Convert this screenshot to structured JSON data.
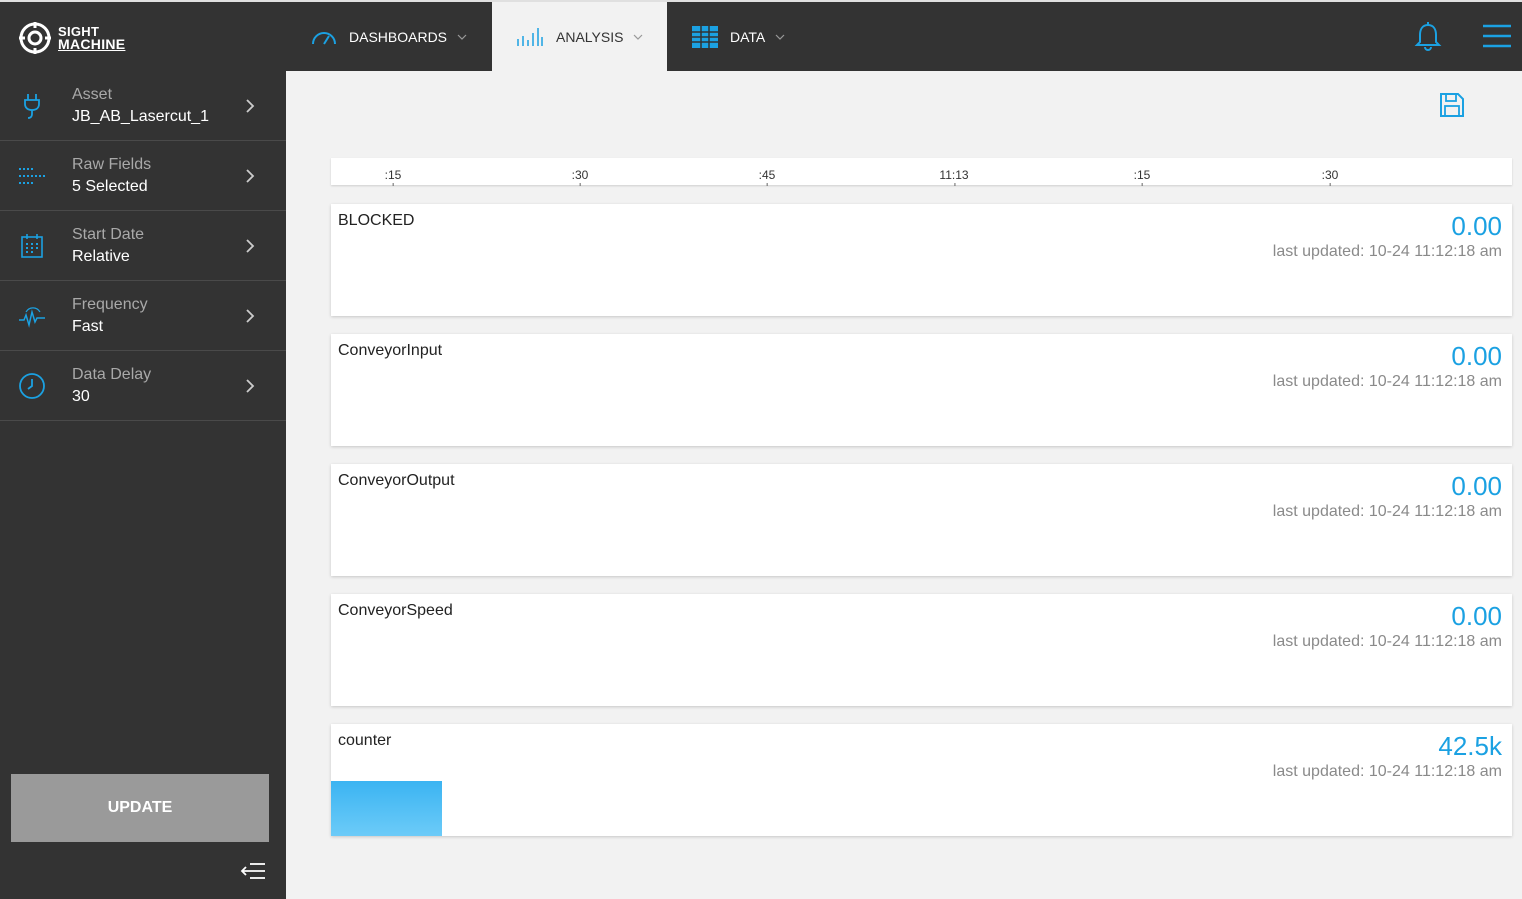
{
  "brand": {
    "line1": "SIGHT",
    "line2": "MACHINE"
  },
  "nav": {
    "tabs": [
      {
        "label": "DASHBOARDS",
        "icon": "gauge-icon"
      },
      {
        "label": "ANALYSIS",
        "icon": "bar-chart-icon"
      },
      {
        "label": "DATA",
        "icon": "grid-table-icon"
      }
    ]
  },
  "sidebar": {
    "items": [
      {
        "label": "Asset",
        "value": "JB_AB_Lasercut_1",
        "icon": "plug-icon"
      },
      {
        "label": "Raw Fields",
        "value": "5 Selected",
        "icon": "dots-grid-icon"
      },
      {
        "label": "Start Date",
        "value": "Relative",
        "icon": "calendar-icon"
      },
      {
        "label": "Frequency",
        "value": "Fast",
        "icon": "waveform-icon"
      },
      {
        "label": "Data Delay",
        "value": "30",
        "icon": "clock-icon"
      }
    ],
    "update_label": "UPDATE"
  },
  "timeline": {
    "ticks": [
      ":15",
      ":30",
      ":45",
      "11:13",
      ":15",
      ":30"
    ]
  },
  "cards": [
    {
      "name": "BLOCKED",
      "value": "0.00",
      "updated": "last updated: 10-24 11:12:18 am"
    },
    {
      "name": "ConveyorInput",
      "value": "0.00",
      "updated": "last updated: 10-24 11:12:18 am"
    },
    {
      "name": "ConveyorOutput",
      "value": "0.00",
      "updated": "last updated: 10-24 11:12:18 am"
    },
    {
      "name": "ConveyorSpeed",
      "value": "0.00",
      "updated": "last updated: 10-24 11:12:18 am"
    },
    {
      "name": "counter",
      "value": "42.5k",
      "updated": "last updated: 10-24 11:12:18 am"
    }
  ],
  "colors": {
    "accent": "#1ba1e2",
    "topbar": "#333333",
    "sidebar": "#333333",
    "content_bg": "#f2f2f2",
    "update_button": "#9a9a9a"
  }
}
